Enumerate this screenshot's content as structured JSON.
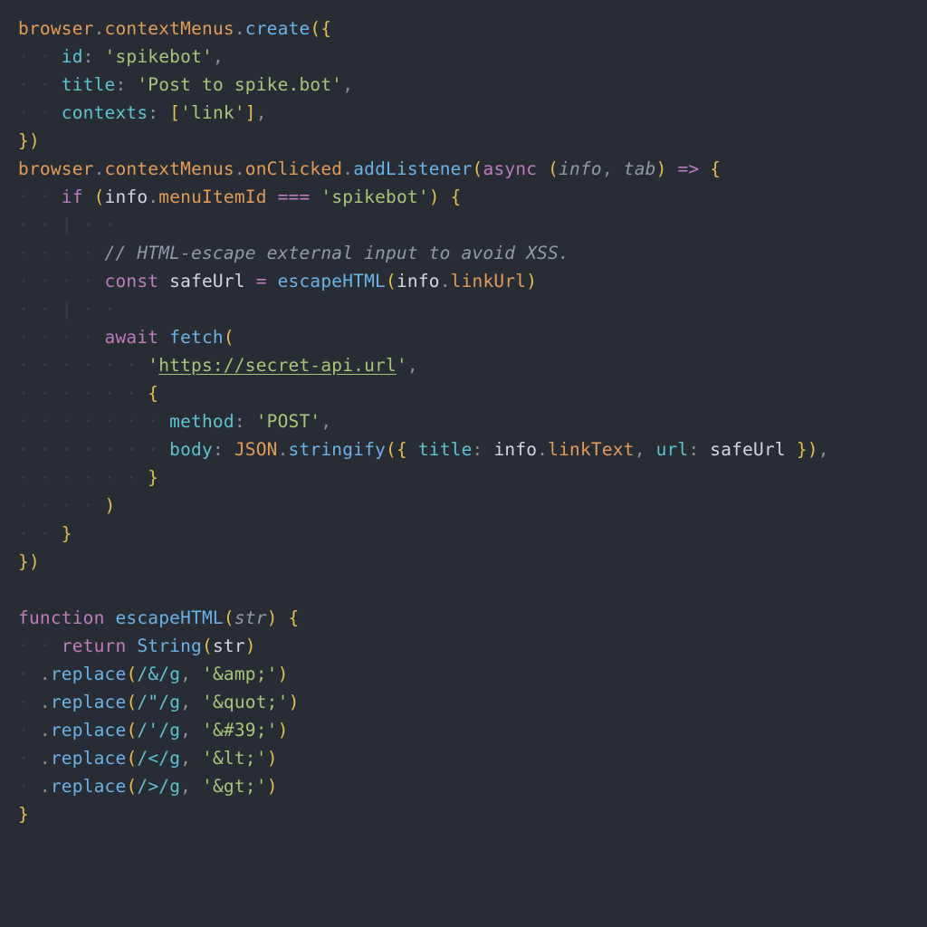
{
  "code": {
    "lines": [
      [
        {
          "cls": "tk-obj",
          "t": "browser"
        },
        {
          "cls": "tk-op",
          "t": "."
        },
        {
          "cls": "tk-obj",
          "t": "contextMenus"
        },
        {
          "cls": "tk-op",
          "t": "."
        },
        {
          "cls": "tk-fn",
          "t": "create"
        },
        {
          "cls": "tk-punc",
          "t": "({"
        }
      ],
      [
        {
          "cls": "guide",
          "t": "· · "
        },
        {
          "cls": "tk-prop",
          "t": "id"
        },
        {
          "cls": "tk-op",
          "t": ": "
        },
        {
          "cls": "tk-str",
          "t": "'spikebot'"
        },
        {
          "cls": "tk-op",
          "t": ","
        }
      ],
      [
        {
          "cls": "guide",
          "t": "· · "
        },
        {
          "cls": "tk-prop",
          "t": "title"
        },
        {
          "cls": "tk-op",
          "t": ": "
        },
        {
          "cls": "tk-str",
          "t": "'Post to spike.bot'"
        },
        {
          "cls": "tk-op",
          "t": ","
        }
      ],
      [
        {
          "cls": "guide",
          "t": "· · "
        },
        {
          "cls": "tk-prop",
          "t": "contexts"
        },
        {
          "cls": "tk-op",
          "t": ": "
        },
        {
          "cls": "tk-punc",
          "t": "["
        },
        {
          "cls": "tk-str",
          "t": "'link'"
        },
        {
          "cls": "tk-punc",
          "t": "]"
        },
        {
          "cls": "tk-op",
          "t": ","
        }
      ],
      [
        {
          "cls": "tk-punc",
          "t": "})"
        }
      ],
      [
        {
          "cls": "tk-obj",
          "t": "browser"
        },
        {
          "cls": "tk-op",
          "t": "."
        },
        {
          "cls": "tk-obj",
          "t": "contextMenus"
        },
        {
          "cls": "tk-op",
          "t": "."
        },
        {
          "cls": "tk-obj",
          "t": "onClicked"
        },
        {
          "cls": "tk-op",
          "t": "."
        },
        {
          "cls": "tk-fn",
          "t": "addListener"
        },
        {
          "cls": "tk-punc",
          "t": "("
        },
        {
          "cls": "tk-kw",
          "t": "async "
        },
        {
          "cls": "tk-punc",
          "t": "("
        },
        {
          "cls": "tk-param",
          "t": "info"
        },
        {
          "cls": "tk-op",
          "t": ", "
        },
        {
          "cls": "tk-param",
          "t": "tab"
        },
        {
          "cls": "tk-punc",
          "t": ")"
        },
        {
          "cls": "tk-kw",
          "t": " => "
        },
        {
          "cls": "tk-punc",
          "t": "{"
        }
      ],
      [
        {
          "cls": "guide",
          "t": "· · "
        },
        {
          "cls": "tk-kw",
          "t": "if "
        },
        {
          "cls": "tk-punc",
          "t": "("
        },
        {
          "cls": "tk-id",
          "t": "info"
        },
        {
          "cls": "tk-op",
          "t": "."
        },
        {
          "cls": "tk-obj",
          "t": "menuItemId"
        },
        {
          "cls": "tk-kw",
          "t": " === "
        },
        {
          "cls": "tk-str",
          "t": "'spikebot'"
        },
        {
          "cls": "tk-punc",
          "t": ") {"
        }
      ],
      [
        {
          "cls": "guide",
          "t": "· · | · · "
        }
      ],
      [
        {
          "cls": "guide",
          "t": "· · · · "
        },
        {
          "cls": "tk-cmt",
          "t": "// HTML-escape external input to avoid XSS."
        }
      ],
      [
        {
          "cls": "guide",
          "t": "· · · · "
        },
        {
          "cls": "tk-kw",
          "t": "const "
        },
        {
          "cls": "tk-id",
          "t": "safeUrl"
        },
        {
          "cls": "tk-kw",
          "t": " = "
        },
        {
          "cls": "tk-fn",
          "t": "escapeHTML"
        },
        {
          "cls": "tk-punc",
          "t": "("
        },
        {
          "cls": "tk-id",
          "t": "info"
        },
        {
          "cls": "tk-op",
          "t": "."
        },
        {
          "cls": "tk-obj",
          "t": "linkUrl"
        },
        {
          "cls": "tk-punc",
          "t": ")"
        }
      ],
      [
        {
          "cls": "guide",
          "t": "· · | · · "
        }
      ],
      [
        {
          "cls": "guide",
          "t": "· · · · "
        },
        {
          "cls": "tk-kw",
          "t": "await "
        },
        {
          "cls": "tk-fn",
          "t": "fetch"
        },
        {
          "cls": "tk-punc",
          "t": "("
        }
      ],
      [
        {
          "cls": "guide",
          "t": "· · · · · · "
        },
        {
          "cls": "tk-str",
          "t": "'"
        },
        {
          "cls": "tk-str tk-link",
          "t": "https://secret-api.url"
        },
        {
          "cls": "tk-str",
          "t": "'"
        },
        {
          "cls": "tk-op",
          "t": ","
        }
      ],
      [
        {
          "cls": "guide",
          "t": "· · · · · · "
        },
        {
          "cls": "tk-punc",
          "t": "{"
        }
      ],
      [
        {
          "cls": "guide",
          "t": "· · · · · · · "
        },
        {
          "cls": "tk-prop",
          "t": "method"
        },
        {
          "cls": "tk-op",
          "t": ": "
        },
        {
          "cls": "tk-str",
          "t": "'POST'"
        },
        {
          "cls": "tk-op",
          "t": ","
        }
      ],
      [
        {
          "cls": "guide",
          "t": "· · · · · · · "
        },
        {
          "cls": "tk-prop",
          "t": "body"
        },
        {
          "cls": "tk-op",
          "t": ": "
        },
        {
          "cls": "tk-obj",
          "t": "JSON"
        },
        {
          "cls": "tk-op",
          "t": "."
        },
        {
          "cls": "tk-fn",
          "t": "stringify"
        },
        {
          "cls": "tk-punc",
          "t": "({ "
        },
        {
          "cls": "tk-prop",
          "t": "title"
        },
        {
          "cls": "tk-op",
          "t": ": "
        },
        {
          "cls": "tk-id",
          "t": "info"
        },
        {
          "cls": "tk-op",
          "t": "."
        },
        {
          "cls": "tk-obj",
          "t": "linkText"
        },
        {
          "cls": "tk-op",
          "t": ", "
        },
        {
          "cls": "tk-prop",
          "t": "url"
        },
        {
          "cls": "tk-op",
          "t": ": "
        },
        {
          "cls": "tk-id",
          "t": "safeUrl"
        },
        {
          "cls": "tk-punc",
          "t": " })"
        },
        {
          "cls": "tk-op",
          "t": ","
        }
      ],
      [
        {
          "cls": "guide",
          "t": "· · · · · · "
        },
        {
          "cls": "tk-punc",
          "t": "}"
        }
      ],
      [
        {
          "cls": "guide",
          "t": "· · · · "
        },
        {
          "cls": "tk-punc",
          "t": ")"
        }
      ],
      [
        {
          "cls": "guide",
          "t": "· · "
        },
        {
          "cls": "tk-punc",
          "t": "}"
        }
      ],
      [
        {
          "cls": "tk-punc",
          "t": "})"
        }
      ],
      [
        {
          "cls": "",
          "t": " "
        }
      ],
      [
        {
          "cls": "tk-kw",
          "t": "function "
        },
        {
          "cls": "tk-fn",
          "t": "escapeHTML"
        },
        {
          "cls": "tk-punc",
          "t": "("
        },
        {
          "cls": "tk-param",
          "t": "str"
        },
        {
          "cls": "tk-punc",
          "t": ") {"
        }
      ],
      [
        {
          "cls": "guide",
          "t": "· · "
        },
        {
          "cls": "tk-kw",
          "t": "return "
        },
        {
          "cls": "tk-fn",
          "t": "String"
        },
        {
          "cls": "tk-punc",
          "t": "("
        },
        {
          "cls": "tk-id",
          "t": "str"
        },
        {
          "cls": "tk-punc",
          "t": ")"
        }
      ],
      [
        {
          "cls": "guide",
          "t": "· "
        },
        {
          "cls": "tk-op",
          "t": "."
        },
        {
          "cls": "tk-fn",
          "t": "replace"
        },
        {
          "cls": "tk-punc",
          "t": "("
        },
        {
          "cls": "tk-re",
          "t": "/&/g"
        },
        {
          "cls": "tk-op",
          "t": ", "
        },
        {
          "cls": "tk-str",
          "t": "'&amp;'"
        },
        {
          "cls": "tk-punc",
          "t": ")"
        }
      ],
      [
        {
          "cls": "guide",
          "t": "· "
        },
        {
          "cls": "tk-op",
          "t": "."
        },
        {
          "cls": "tk-fn",
          "t": "replace"
        },
        {
          "cls": "tk-punc",
          "t": "("
        },
        {
          "cls": "tk-re",
          "t": "/\"/g"
        },
        {
          "cls": "tk-op",
          "t": ", "
        },
        {
          "cls": "tk-str",
          "t": "'&quot;'"
        },
        {
          "cls": "tk-punc",
          "t": ")"
        }
      ],
      [
        {
          "cls": "guide",
          "t": "· "
        },
        {
          "cls": "tk-op",
          "t": "."
        },
        {
          "cls": "tk-fn",
          "t": "replace"
        },
        {
          "cls": "tk-punc",
          "t": "("
        },
        {
          "cls": "tk-re",
          "t": "/'/g"
        },
        {
          "cls": "tk-op",
          "t": ", "
        },
        {
          "cls": "tk-str",
          "t": "'&#39;'"
        },
        {
          "cls": "tk-punc",
          "t": ")"
        }
      ],
      [
        {
          "cls": "guide",
          "t": "· "
        },
        {
          "cls": "tk-op",
          "t": "."
        },
        {
          "cls": "tk-fn",
          "t": "replace"
        },
        {
          "cls": "tk-punc",
          "t": "("
        },
        {
          "cls": "tk-re",
          "t": "/</g"
        },
        {
          "cls": "tk-op",
          "t": ", "
        },
        {
          "cls": "tk-str",
          "t": "'&lt;'"
        },
        {
          "cls": "tk-punc",
          "t": ")"
        }
      ],
      [
        {
          "cls": "guide",
          "t": "· "
        },
        {
          "cls": "tk-op",
          "t": "."
        },
        {
          "cls": "tk-fn",
          "t": "replace"
        },
        {
          "cls": "tk-punc",
          "t": "("
        },
        {
          "cls": "tk-re",
          "t": "/>/g"
        },
        {
          "cls": "tk-op",
          "t": ", "
        },
        {
          "cls": "tk-str",
          "t": "'&gt;'"
        },
        {
          "cls": "tk-punc",
          "t": ")"
        }
      ],
      [
        {
          "cls": "tk-punc",
          "t": "}"
        }
      ]
    ]
  }
}
